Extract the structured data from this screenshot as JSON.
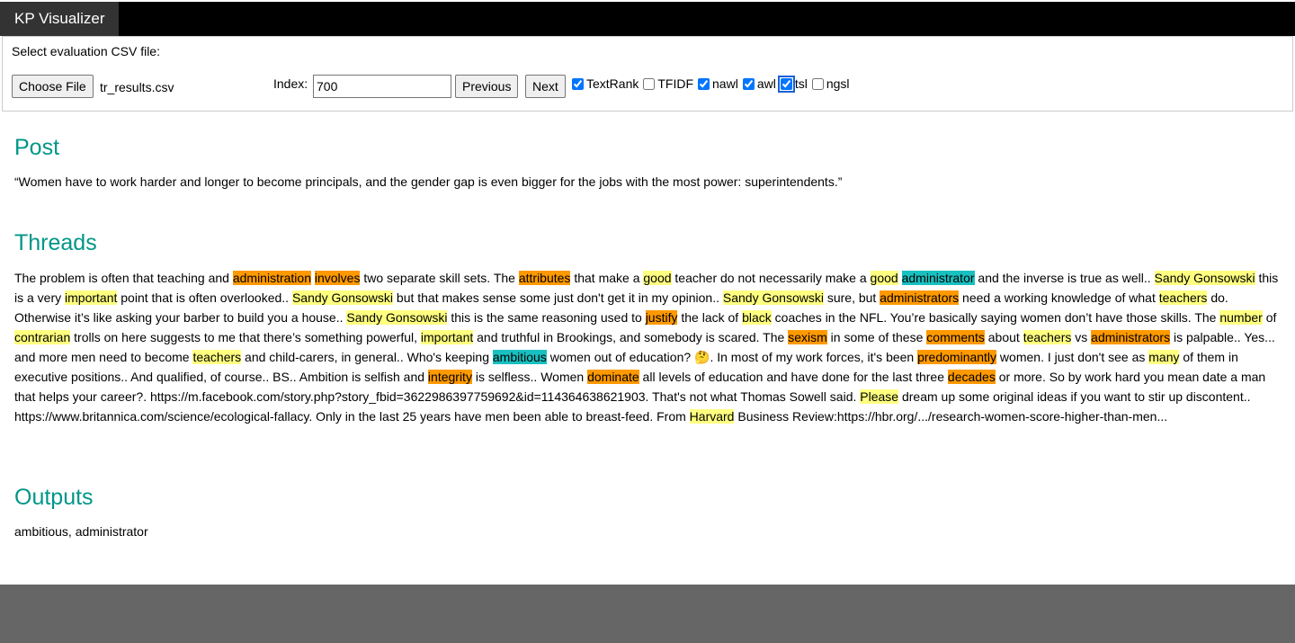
{
  "app": {
    "title": "KP Visualizer"
  },
  "controls": {
    "select_label": "Select evaluation CSV file:",
    "choose_file_label": "Choose File",
    "file_name": "tr_results.csv",
    "index_label": "Index:",
    "index_value": "700",
    "previous_label": "Previous",
    "next_label": "Next",
    "checkboxes": [
      {
        "label": "TextRank",
        "checked": true
      },
      {
        "label": "TFIDF",
        "checked": false
      },
      {
        "label": "nawl",
        "checked": true
      },
      {
        "label": "awl",
        "checked": true
      },
      {
        "label": "tsl",
        "checked": true,
        "focused": true
      },
      {
        "label": "ngsl",
        "checked": false
      }
    ]
  },
  "post": {
    "heading": "Post",
    "text": "“Women have to work harder and longer to become principals, and the gender gap is even bigger for the jobs with the most power: superintendents.”"
  },
  "threads": {
    "heading": "Threads",
    "highlight_colors": {
      "yellow": "#ffff80",
      "orange": "#ff9900",
      "teal": "#19c0c0"
    },
    "segments": [
      {
        "t": "The problem is often that teaching and "
      },
      {
        "t": "administration",
        "h": "orange"
      },
      {
        "t": " "
      },
      {
        "t": "involves",
        "h": "orange"
      },
      {
        "t": " two separate skill sets. The "
      },
      {
        "t": "attributes",
        "h": "orange"
      },
      {
        "t": " that make a "
      },
      {
        "t": "good",
        "h": "yellow"
      },
      {
        "t": " teacher do not necessarily make a "
      },
      {
        "t": "good",
        "h": "yellow"
      },
      {
        "t": " "
      },
      {
        "t": "administrator",
        "h": "teal"
      },
      {
        "t": " and the inverse is true as well.. "
      },
      {
        "t": "Sandy Gonsowski",
        "h": "yellow"
      },
      {
        "t": " this is a very "
      },
      {
        "t": "important",
        "h": "yellow"
      },
      {
        "t": " point that is often overlooked.. "
      },
      {
        "t": "Sandy Gonsowski",
        "h": "yellow"
      },
      {
        "t": " but that makes sense some just don't get it in my opinion.. "
      },
      {
        "t": "Sandy Gonsowski",
        "h": "yellow"
      },
      {
        "t": " sure, but "
      },
      {
        "t": "administrators",
        "h": "orange"
      },
      {
        "t": " need a working knowledge of what "
      },
      {
        "t": "teachers",
        "h": "yellow"
      },
      {
        "t": " do. Otherwise it’s like asking your barber to build you a house.. "
      },
      {
        "t": "Sandy Gonsowski",
        "h": "yellow"
      },
      {
        "t": " this is the same reasoning used to "
      },
      {
        "t": "justify",
        "h": "orange"
      },
      {
        "t": " the lack of "
      },
      {
        "t": "black",
        "h": "yellow"
      },
      {
        "t": " coaches in the NFL. You’re basically saying women don’t have those skills. The "
      },
      {
        "t": "number",
        "h": "yellow"
      },
      {
        "t": " of "
      },
      {
        "t": "contrarian",
        "h": "yellow"
      },
      {
        "t": " trolls on here suggests to me that there’s something powerful, "
      },
      {
        "t": "important",
        "h": "yellow"
      },
      {
        "t": " and truthful in Brookings, and somebody is scared. The "
      },
      {
        "t": "sexism",
        "h": "orange"
      },
      {
        "t": " in some of these "
      },
      {
        "t": "comments",
        "h": "orange"
      },
      {
        "t": " about "
      },
      {
        "t": "teachers",
        "h": "yellow"
      },
      {
        "t": " vs "
      },
      {
        "t": "administrators",
        "h": "orange"
      },
      {
        "t": " is palpable.. Yes... and more men need to become "
      },
      {
        "t": "teachers",
        "h": "yellow"
      },
      {
        "t": " and child-carers, in general.. Who's keeping "
      },
      {
        "t": "ambitious",
        "h": "teal"
      },
      {
        "t": " women out of education? 🤔. In most of my work forces, it's been "
      },
      {
        "t": "predominantly",
        "h": "orange"
      },
      {
        "t": " women. I just don't see as "
      },
      {
        "t": "many",
        "h": "yellow"
      },
      {
        "t": " of them in executive positions.. And qualified, of course.. BS.. Ambition is selfish and "
      },
      {
        "t": "integrity",
        "h": "orange"
      },
      {
        "t": " is selfless.. Women "
      },
      {
        "t": "dominate",
        "h": "orange"
      },
      {
        "t": " all levels of education and have done for the last three "
      },
      {
        "t": "decades",
        "h": "orange"
      },
      {
        "t": " or more. So by work hard you mean date a man that helps your career?. https://m.facebook.com/story.php?story_fbid=3622986397759692&id=114364638621903. That's not what Thomas Sowell said. "
      },
      {
        "t": "Please",
        "h": "yellow"
      },
      {
        "t": " dream up some original ideas if you want to stir up discontent.. https://www.britannica.com/science/ecological-fallacy. Only in the last 25 years have men been able to breast-feed. From "
      },
      {
        "t": "Harvard",
        "h": "yellow"
      },
      {
        "t": " Business Review:https://hbr.org/.../research-women-score-higher-than-men..."
      }
    ]
  },
  "outputs": {
    "heading": "Outputs",
    "text": "ambitious, administrator"
  }
}
